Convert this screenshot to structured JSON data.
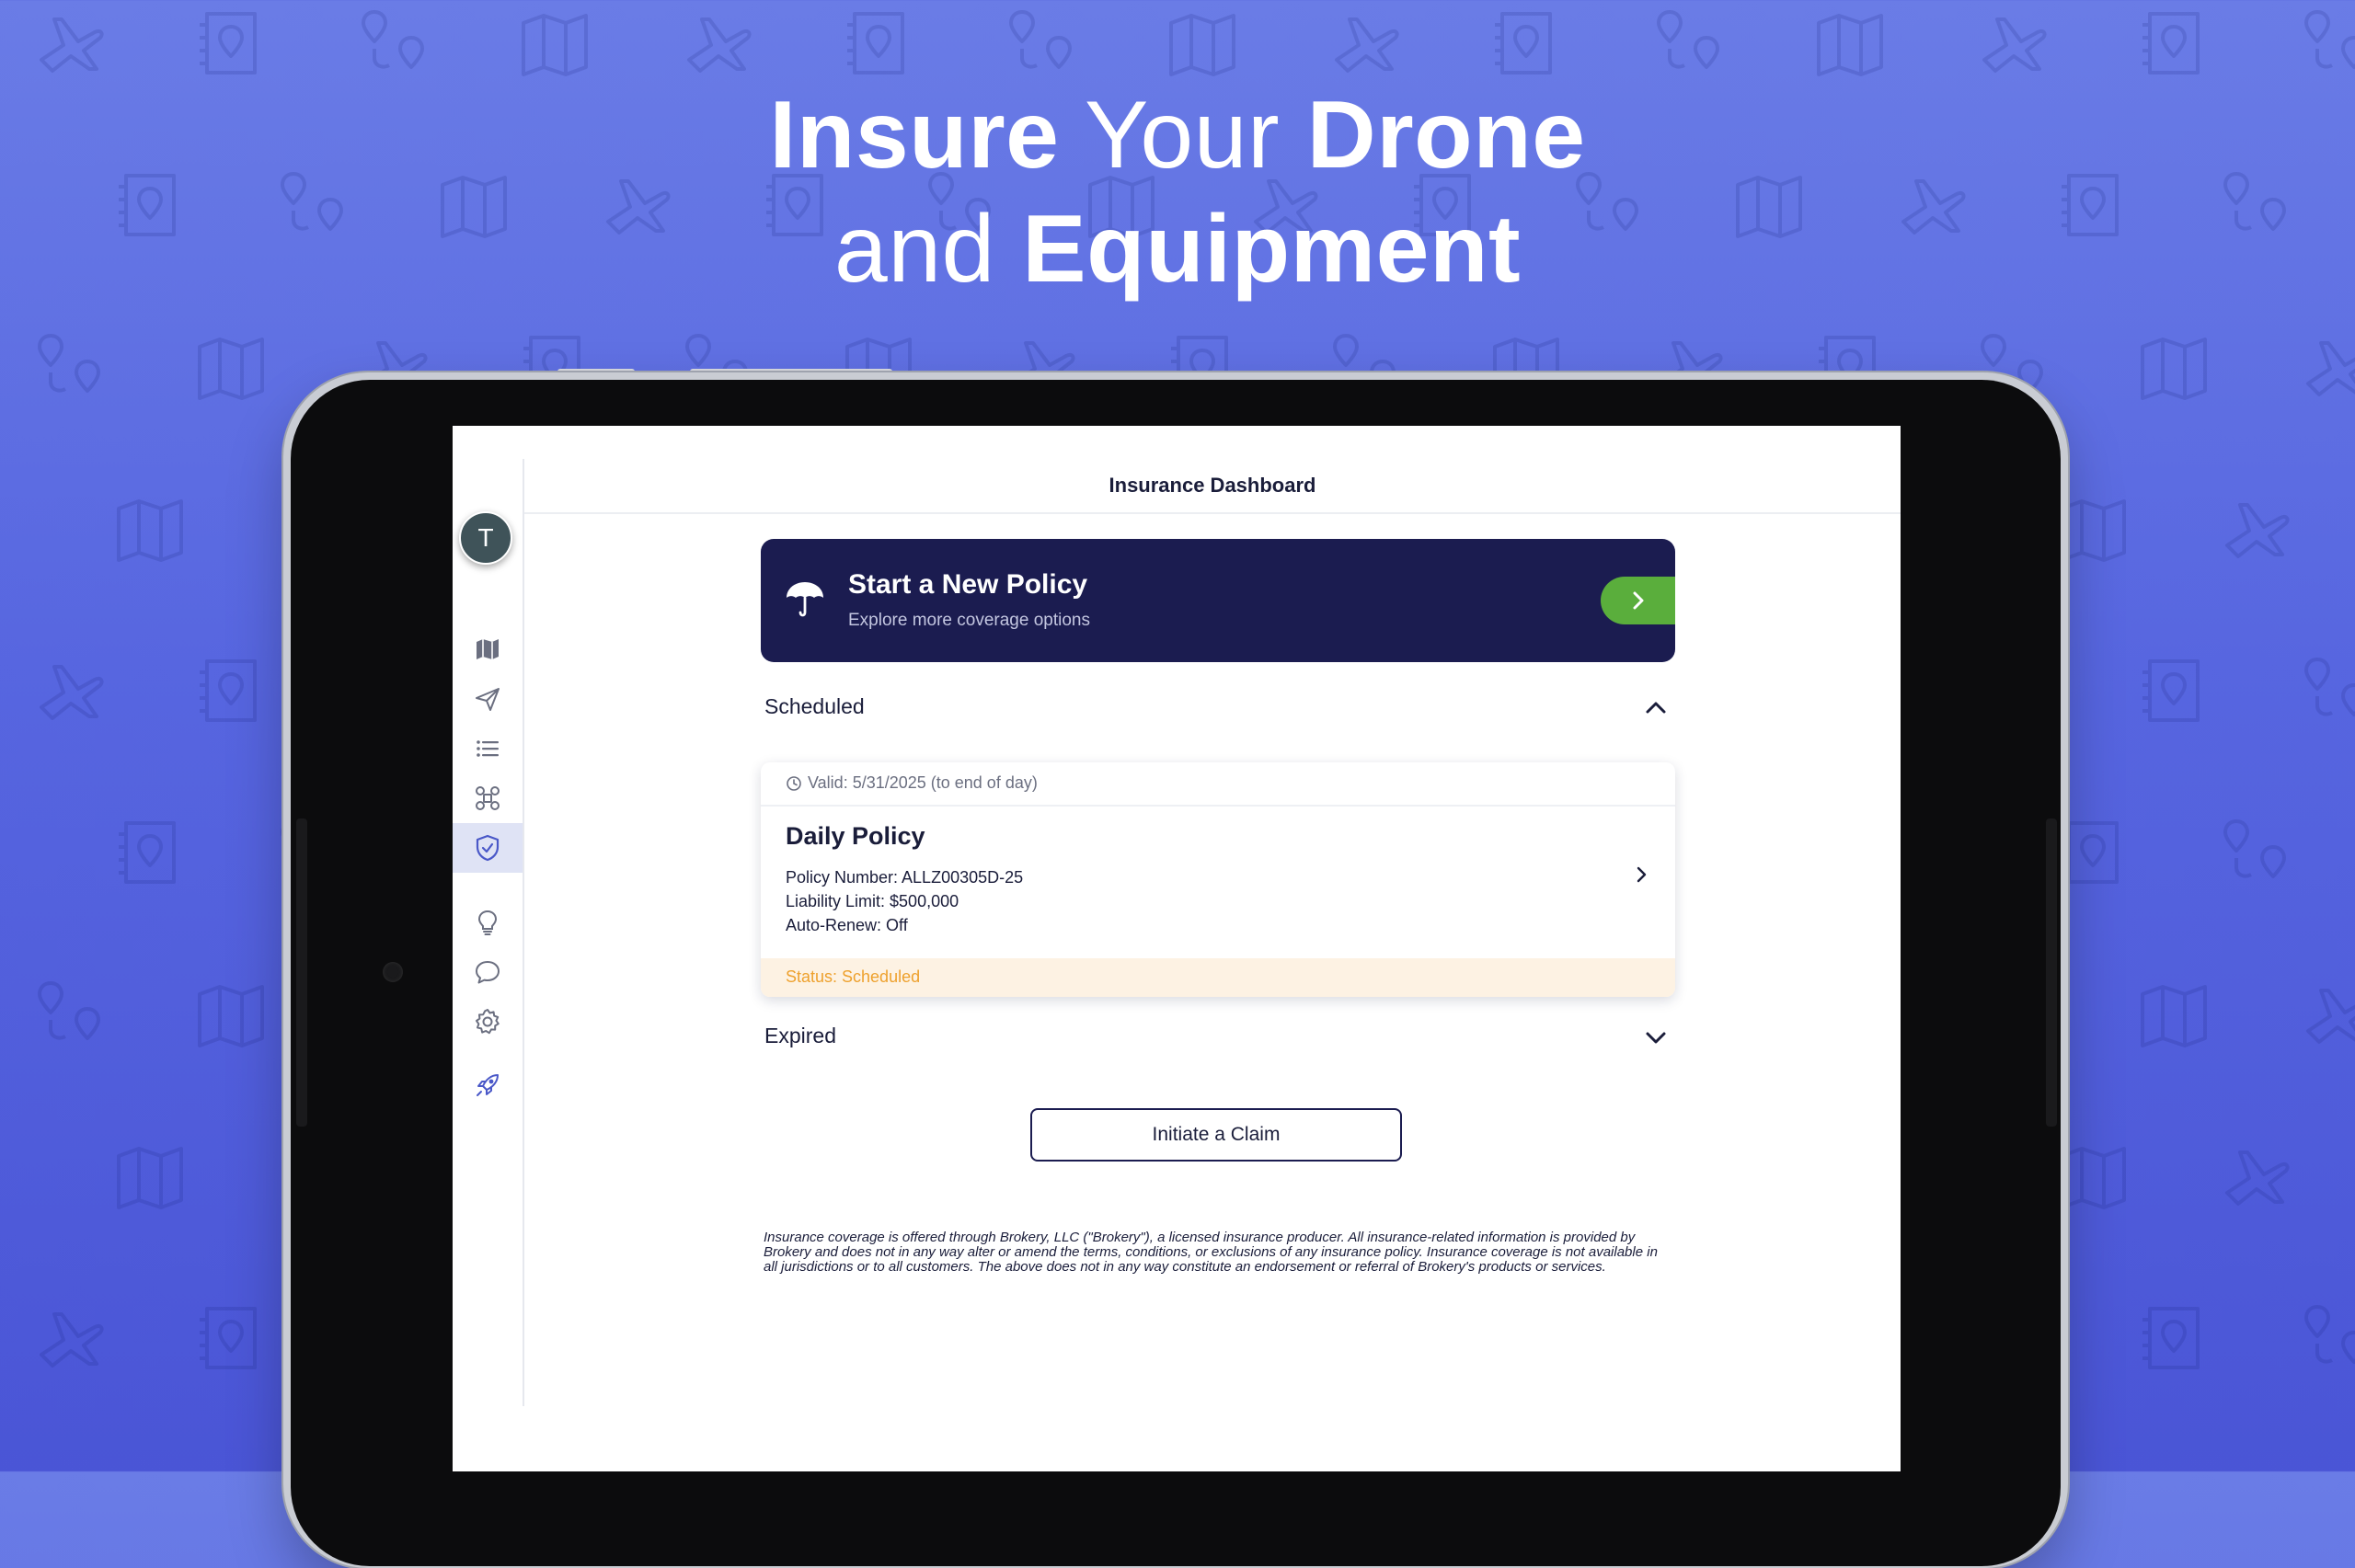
{
  "headline": {
    "line1": {
      "w1": "Insure",
      "w2": "Your",
      "w3": "Drone"
    },
    "line2": {
      "w1": "and",
      "w2": "Equipment"
    }
  },
  "app": {
    "header": {
      "title": "Insurance Dashboard"
    },
    "user": {
      "avatar_initial": "T"
    },
    "sidebar": {
      "items": [
        {
          "icon": "map-icon"
        },
        {
          "icon": "paper-plane-icon"
        },
        {
          "icon": "list-icon"
        },
        {
          "icon": "drone-icon"
        },
        {
          "icon": "shield-check-icon",
          "active": true
        },
        {
          "icon": "lightbulb-icon"
        },
        {
          "icon": "chat-bubble-icon"
        },
        {
          "icon": "gear-icon"
        },
        {
          "icon": "rocket-icon"
        }
      ]
    },
    "promo": {
      "icon": "umbrella-icon",
      "title": "Start a New Policy",
      "subtitle": "Explore more coverage options"
    },
    "sections": {
      "scheduled": {
        "label": "Scheduled",
        "expanded": true
      },
      "expired": {
        "label": "Expired",
        "expanded": false
      }
    },
    "policy": {
      "valid": "Valid: 5/31/2025 (to end of day)",
      "title": "Daily Policy",
      "policy_number": "Policy Number: ALLZ00305D-25",
      "liability_limit": "Liability Limit: $500,000",
      "auto_renew": "Auto-Renew: Off",
      "status": "Status: Scheduled"
    },
    "claim_button": {
      "label": "Initiate a Claim"
    },
    "disclaimer": "Insurance coverage is offered through Brokery, LLC (\"Brokery\"), a licensed insurance producer. All insurance-related information is provided by Brokery and does not in any way alter or amend the terms, conditions, or exclusions of any insurance policy. Insurance coverage is not available in all jurisdictions or to all customers. The above does not in any way constitute an endorsement or referral of Brokery's products or services."
  },
  "colors": {
    "background_top": "#6a7ce6",
    "background_bottom": "#4a55d6",
    "promo_bg": "#1b1c50",
    "accent_green": "#5aae3c",
    "active_nav": "#dfe3f5",
    "status_orange": "#eea12d",
    "status_bg": "#fdf2e3"
  }
}
